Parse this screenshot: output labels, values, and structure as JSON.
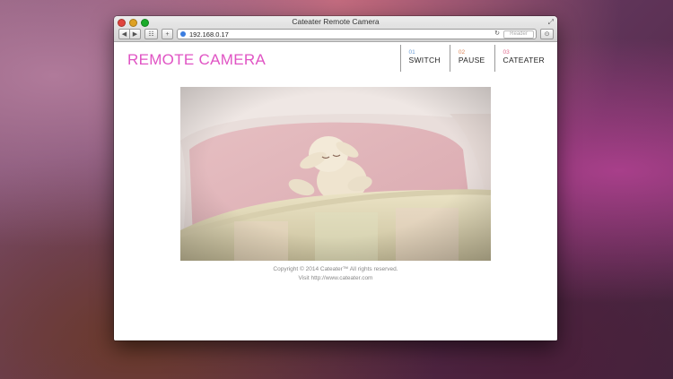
{
  "window": {
    "title": "Cateater Remote Camera"
  },
  "toolbar": {
    "back_label": "◀",
    "forward_label": "▶",
    "grid_label": "☷",
    "new_tab_label": "+",
    "url": "192.168.0.17",
    "reload_label": "↻",
    "reader_label": "Reader",
    "share_label": "⊙",
    "fullscreen_label": "⤢"
  },
  "site": {
    "logo": "REMOTE CAMERA",
    "nav": [
      {
        "num": "01",
        "label": "SWITCH",
        "color": "#6fa0d8"
      },
      {
        "num": "02",
        "label": "PAUSE",
        "color": "#e0885a"
      },
      {
        "num": "03",
        "label": "CATEATER",
        "color": "#e06a8e"
      }
    ],
    "footer": {
      "copyright": "Copyright © 2014 Cateater™ All rights reserved.",
      "visit": "Visit http://www.cateater.com"
    }
  },
  "colors": {
    "logo": "#e054c4"
  }
}
